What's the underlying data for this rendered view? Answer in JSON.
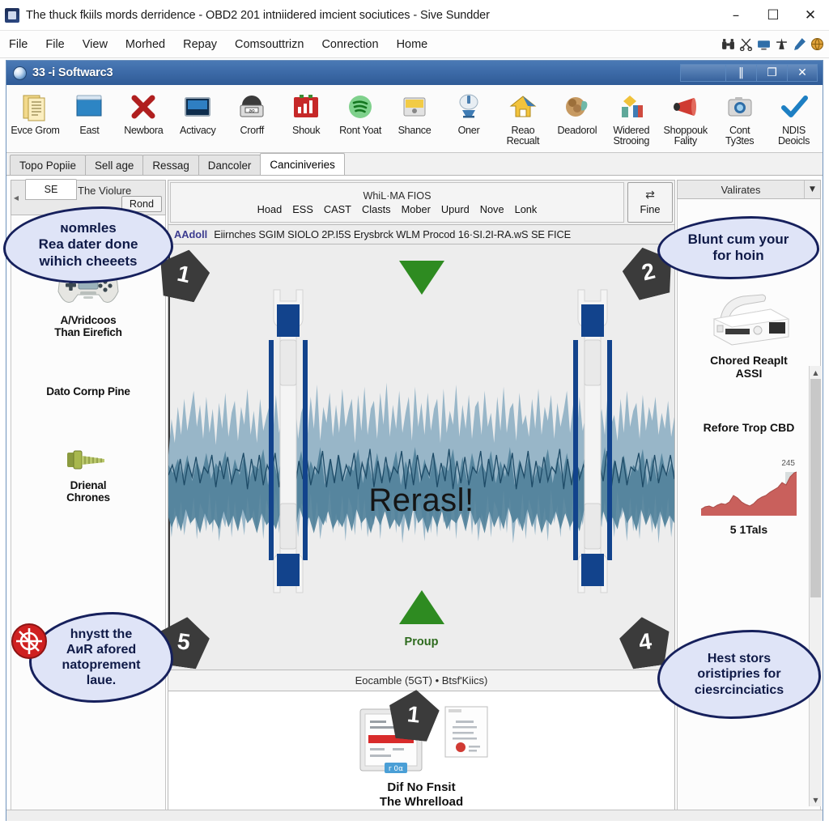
{
  "os_window": {
    "title": "The thuck fkiils mords derridence - OBD2 201 intniidered imcient sociutices - Sive Sundder",
    "app_icon": "app-icon",
    "controls": [
      {
        "name": "minimize",
        "glyph": "–"
      },
      {
        "name": "maximize",
        "glyph": "☐"
      },
      {
        "name": "close",
        "glyph": "✕"
      }
    ]
  },
  "menubar": {
    "items": [
      "File",
      "File",
      "View",
      "Morhed",
      "Repay",
      "Comsouttrizn",
      "Conrection",
      "Home"
    ],
    "tray_icons": [
      "binoculars-icon",
      "scissors-icon",
      "monitor-icon",
      "tower-icon",
      "pen-icon",
      "globe-icon"
    ]
  },
  "app_window": {
    "title": "33 -i Softwarc3",
    "globe_icon": "globe-icon",
    "controls": [
      {
        "name": "restore-blank",
        "glyph": ""
      },
      {
        "name": "chart",
        "glyph": "‖"
      },
      {
        "name": "restore",
        "glyph": "❐"
      },
      {
        "name": "close",
        "glyph": "✕"
      }
    ]
  },
  "ribbon": {
    "items": [
      {
        "label": "Evce Grom",
        "icon": "documents-icon"
      },
      {
        "label": "East",
        "icon": "window-icon"
      },
      {
        "label": "Newbora",
        "icon": "red-x-icon"
      },
      {
        "label": "Activacy",
        "icon": "screen-icon"
      },
      {
        "label": "Crorff",
        "icon": "scanner-icon"
      },
      {
        "label": "Shouk",
        "icon": "bar-chart-icon"
      },
      {
        "label": "Ront Yoat",
        "icon": "green-circle-icon"
      },
      {
        "label": "Shance",
        "icon": "yellow-card-icon"
      },
      {
        "label": "Oner",
        "icon": "satellite-icon"
      },
      {
        "label": "Reao\nRecualt",
        "icon": "house-icon"
      },
      {
        "label": "Deadorol",
        "icon": "brown-blob-icon"
      },
      {
        "label": "Widered\nStrooing",
        "icon": "flag-icon"
      },
      {
        "label": "Shoppouk\nFality",
        "icon": "megaphone-icon"
      },
      {
        "label": "Cont\nTy3tes",
        "icon": "camera-icon"
      },
      {
        "label": "NDIS\nDeoicls",
        "icon": "blue-check-icon"
      }
    ]
  },
  "tabs": [
    {
      "label": "Topo Popiie",
      "active": false
    },
    {
      "label": "Sell age",
      "active": false
    },
    {
      "label": "Ressag",
      "active": false
    },
    {
      "label": "Dancoler",
      "active": false
    },
    {
      "label": "Canciniveries",
      "active": true
    }
  ],
  "left_panel": {
    "subtab": "SE",
    "head_title": "The Violure",
    "button": "Rond",
    "arrow_icon": "chevron-left-icon",
    "items": [
      {
        "caption": "A/Vridcoos\nThan Eirefich",
        "icon": "gamepad-icon"
      },
      {
        "caption": "Dato Cornp Pine",
        "icon": "none"
      },
      {
        "caption": "Drienal\nChrones",
        "icon": "screw-icon"
      }
    ]
  },
  "center_panel": {
    "group_title": "WhiL·MA FIOS",
    "group_items": [
      "Hoad",
      "ESS",
      "CAST",
      "Clasts",
      "Mober",
      "Upurd",
      "Nove",
      "Lonk"
    ],
    "fine_button": {
      "label": "Fine",
      "icon": "shuffle-icon"
    },
    "address": {
      "brand": "AAdoll",
      "text": "Eiirnches SGIM SIOLO 2P.I5S Erysbrck WLM Procod 16·SI.2I-RA.wS SE FICE"
    },
    "canvas": {
      "center_word": "Rerasl!",
      "triangle_label": "Proup",
      "triangle_color": "#2e8b21",
      "clip_icons": [
        "clip-bracket-left-icon",
        "clip-bracket-right-icon"
      ]
    },
    "footer": "Eocamble (5GT) • Btsf'Kiics)",
    "bottom": {
      "caption": "Dif No Fnsit\nThe Whrelload",
      "icons": [
        "clipboard-red-icon",
        "document-icon"
      ],
      "badge_tag": "r 0α"
    }
  },
  "right_panel": {
    "head_title": "Valirates",
    "caret_icon": "chevron-down-icon",
    "items": [
      {
        "caption": "Chored Reaplt\nASSI",
        "icon": "device-icon"
      },
      {
        "caption": "Refore Trop CBD",
        "icon": "none"
      }
    ],
    "chart_caption": "5 1Tals",
    "chart_value": "245"
  },
  "scrollbar": {
    "up_icon": "chevron-up-icon",
    "down_icon": "chevron-down-icon"
  },
  "annotations": {
    "badges": [
      {
        "id": "badge-1-canvas-left",
        "number": "1"
      },
      {
        "id": "badge-2-canvas-right",
        "number": "2"
      },
      {
        "id": "badge-5-lower-left",
        "number": "5"
      },
      {
        "id": "badge-4-lower-right",
        "number": "4"
      },
      {
        "id": "badge-1-bottom",
        "number": "1"
      }
    ],
    "bubbles": [
      {
        "id": "bubble-top-left",
        "text": "ɴomʀles\nRea dater done\nwihich cheeets"
      },
      {
        "id": "bubble-top-right",
        "text": "Blunt сum your\nfor hoin"
      },
      {
        "id": "bubble-bottom-left",
        "text": "hnystt the\nAиR afored\nnatoprement\nlaue."
      },
      {
        "id": "bubble-bottom-right",
        "text": "Hest stors\noristipries for\nciesrcinciatics"
      }
    ],
    "no_entry_icon": "no-entry-icon"
  },
  "chart_data": {
    "type": "area",
    "title": "5 1Tals",
    "x": [
      0,
      1,
      2,
      3,
      4,
      5,
      6,
      7,
      8,
      9,
      10,
      11,
      12,
      13,
      14,
      15,
      16,
      17,
      18,
      19,
      20,
      21,
      22,
      23,
      24
    ],
    "values": [
      42,
      48,
      52,
      50,
      58,
      62,
      60,
      66,
      88,
      82,
      70,
      64,
      60,
      66,
      78,
      84,
      88,
      96,
      104,
      112,
      128,
      120,
      150,
      200,
      245
    ],
    "ylim": [
      0,
      260
    ],
    "annotation": "245",
    "color": "#c9605c",
    "grid": false,
    "legend": "none"
  }
}
